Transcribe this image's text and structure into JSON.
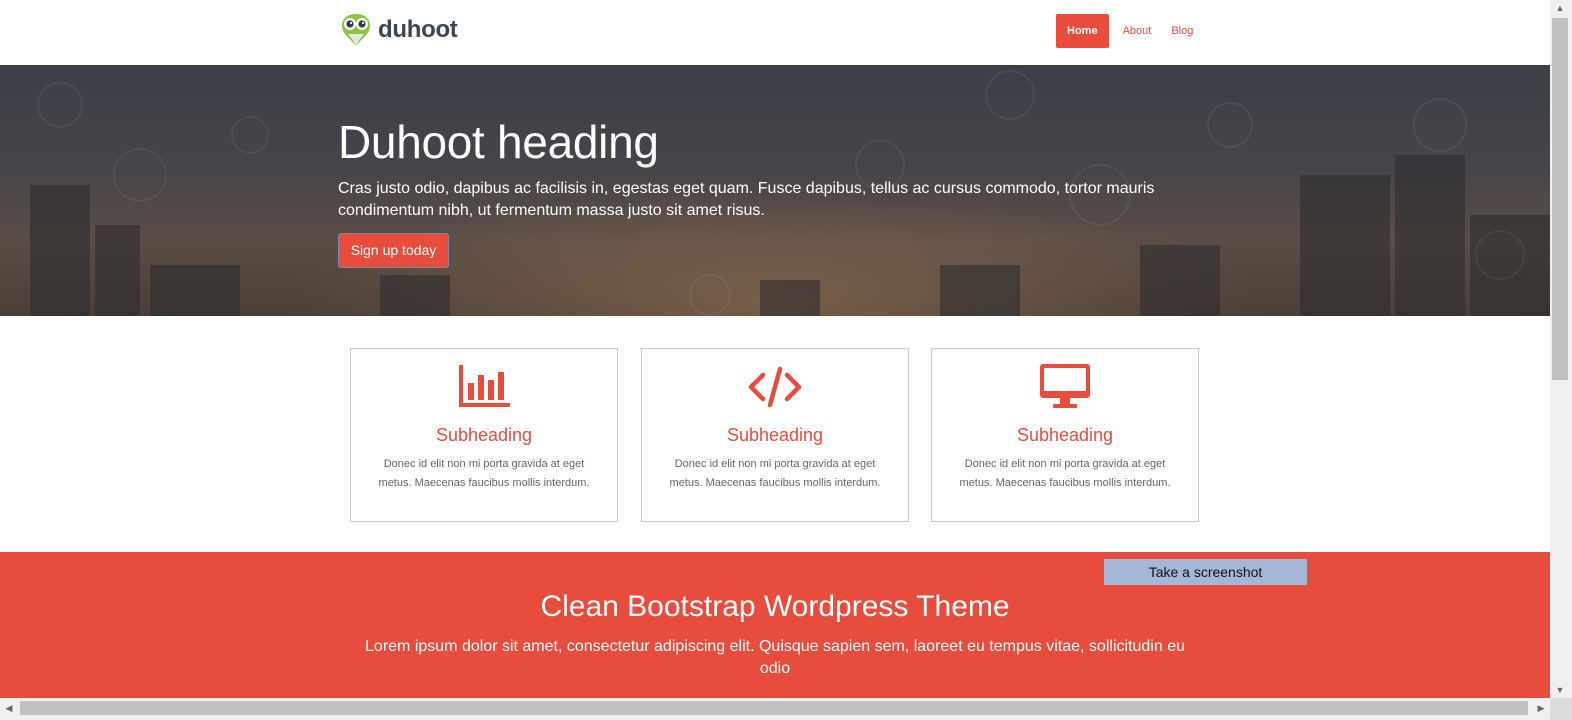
{
  "brand": {
    "name": "duhoot"
  },
  "nav": {
    "items": [
      {
        "label": "Home"
      },
      {
        "label": "About"
      },
      {
        "label": "Blog"
      }
    ]
  },
  "hero": {
    "title": "Duhoot heading",
    "text": "Cras justo odio, dapibus ac facilisis in, egestas eget quam. Fusce dapibus, tellus ac cursus commodo, tortor mauris condimentum nibh, ut fermentum massa justo sit amet risus.",
    "button": "Sign up today"
  },
  "features": [
    {
      "icon": "bar-chart-icon",
      "heading": "Subheading",
      "text": "Donec id elit non mi porta gravida at eget metus. Maecenas faucibus mollis interdum."
    },
    {
      "icon": "code-icon",
      "heading": "Subheading",
      "text": "Donec id elit non mi porta gravida at eget metus. Maecenas faucibus mollis interdum."
    },
    {
      "icon": "desktop-icon",
      "heading": "Subheading",
      "text": "Donec id elit non mi porta gravida at eget metus. Maecenas faucibus mollis interdum."
    }
  ],
  "promo": {
    "title": "Clean Bootstrap Wordpress Theme",
    "text": "Lorem ipsum dolor sit amet, consectetur adipiscing elit. Quisque sapien sem, laoreet eu tempus vitae, sollicitudin eu odio"
  },
  "screenshot_button": {
    "label": "Take a screenshot"
  },
  "colors": {
    "accent": "#e74c3c",
    "text_dark": "#3d4752",
    "screenshot_button": "#a4b7d8"
  }
}
